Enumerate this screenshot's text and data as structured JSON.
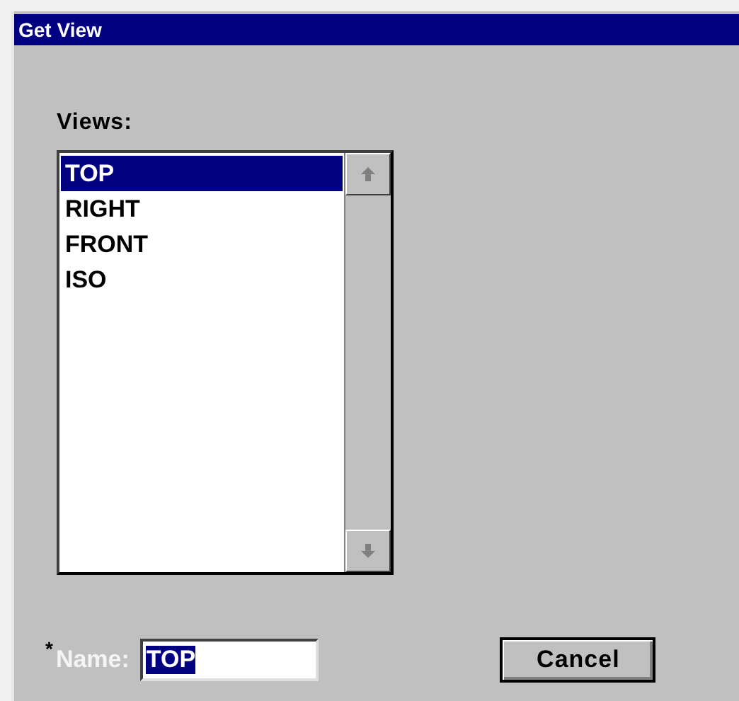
{
  "window": {
    "title": "Get View"
  },
  "views": {
    "label": "Views:",
    "items": [
      {
        "label": "TOP",
        "selected": true
      },
      {
        "label": "RIGHT",
        "selected": false
      },
      {
        "label": "FRONT",
        "selected": false
      },
      {
        "label": "ISO",
        "selected": false
      }
    ]
  },
  "name_field": {
    "required_mark": "*",
    "label": "Name:",
    "value": "TOP",
    "text_selected": true
  },
  "buttons": [
    "Cancel"
  ]
}
